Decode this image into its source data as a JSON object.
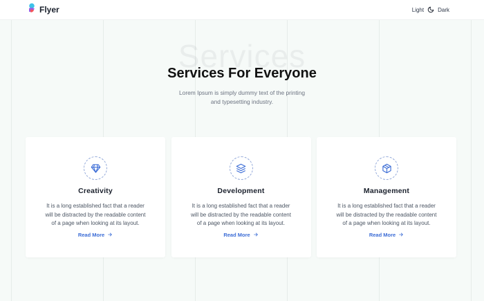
{
  "colors": {
    "accent": "#3b6cd6",
    "background": "#f6faf8",
    "card": "#ffffff",
    "title": "#111111"
  },
  "navbar": {
    "brand": "Flyer",
    "brand_icon": "flyer-logo-icon",
    "theme_light": "Light",
    "theme_icon": "moon-icon",
    "theme_dark": "Dark"
  },
  "hero": {
    "watermark": "Services",
    "title": "Services For Everyone",
    "subtitle": "Lorem Ipsum is simply dummy text of the printing and typesetting industry."
  },
  "services": [
    {
      "icon": "diamond-icon",
      "title": "Creativity",
      "text": "It is a long established fact that a reader will be distracted by the readable content of a page when looking at its layout.",
      "link": "Read More"
    },
    {
      "icon": "layers-icon",
      "title": "Development",
      "text": "It is a long established fact that a reader will be distracted by the readable content of a page when looking at its layout.",
      "link": "Read More"
    },
    {
      "icon": "box-icon",
      "title": "Management",
      "text": "It is a long established fact that a reader will be distracted by the readable content of a page when looking at its layout.",
      "link": "Read More"
    }
  ]
}
